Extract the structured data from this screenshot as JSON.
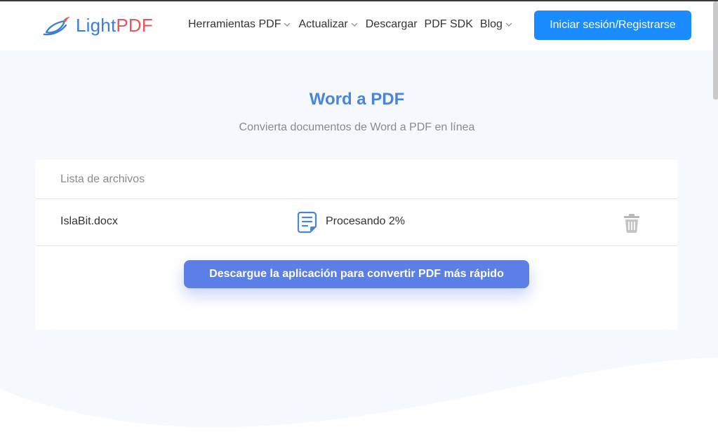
{
  "brand": {
    "name_part1": "Light",
    "name_part2": "PDF",
    "colors": {
      "light": "#3b7ddb",
      "pdf": "#e8545a"
    },
    "icon": "bird-logo-icon"
  },
  "nav": {
    "items": [
      {
        "label": "Herramientas PDF",
        "has_dropdown": true
      },
      {
        "label": "Actualizar",
        "has_dropdown": true
      },
      {
        "label": "Descargar",
        "has_dropdown": false
      },
      {
        "label": "PDF SDK",
        "has_dropdown": false
      },
      {
        "label": "Blog",
        "has_dropdown": true
      }
    ],
    "login_label": "Iniciar sesión/Registrarse",
    "accent": "#1a8cff"
  },
  "main": {
    "title": "Word a PDF",
    "subtitle": "Convierta documentos de Word a PDF en línea",
    "title_color": "#4a84dd"
  },
  "file_list": {
    "header": "Lista de archivos",
    "files": [
      {
        "name": "IslaBit.docx",
        "status": "Procesando 2%",
        "progress": 0.02,
        "icon": "document-icon",
        "action_icon": "trash-icon"
      }
    ]
  },
  "cta": {
    "label": "Descargue la aplicación para convertir PDF más rápido",
    "color": "#5b7fe6"
  }
}
